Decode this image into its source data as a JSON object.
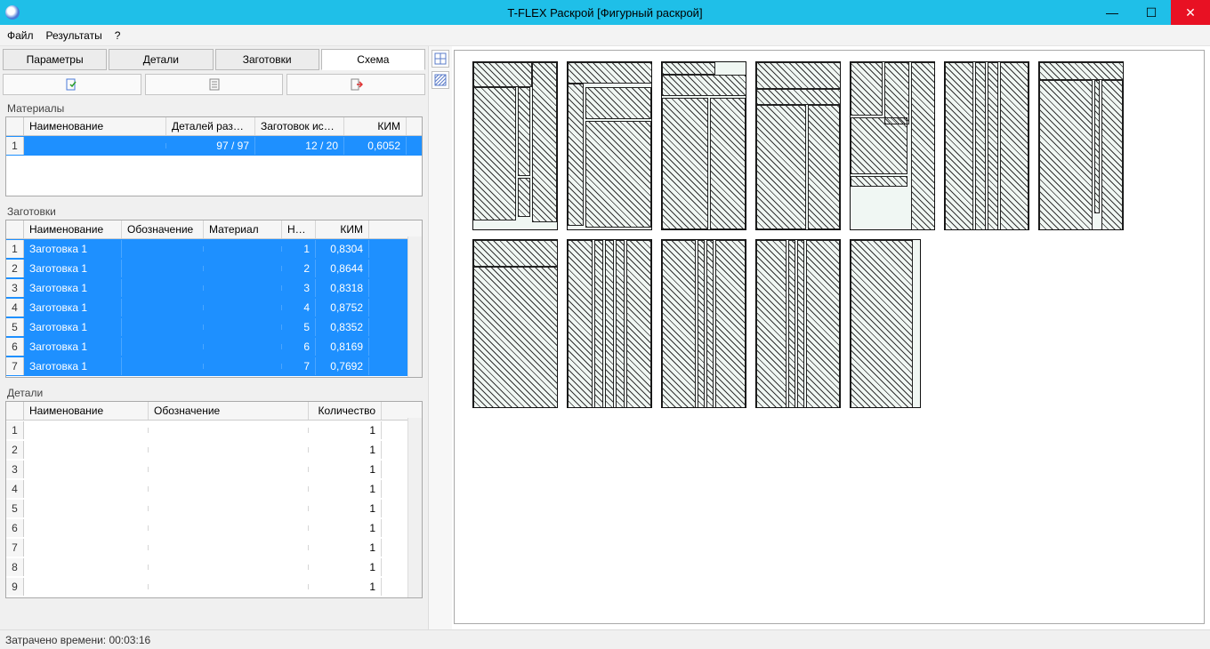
{
  "window": {
    "title": "T-FLEX Раскрой [Фигурный раскрой]"
  },
  "menu": {
    "file": "Файл",
    "results": "Результаты",
    "help": "?"
  },
  "tabs": {
    "params": "Параметры",
    "details": "Детали",
    "blanks": "Заготовки",
    "scheme": "Схема"
  },
  "sections": {
    "materials": "Материалы",
    "blanks": "Заготовки",
    "details": "Детали"
  },
  "materials": {
    "cols": {
      "name": "Наименование",
      "placed": "Деталей разме...",
      "blanks_used": "Заготовок испо...",
      "kim": "КИМ"
    },
    "rows": [
      {
        "n": "1",
        "name": "",
        "placed": "97 / 97",
        "blanks_used": "12 / 20",
        "kim": "0,6052"
      }
    ]
  },
  "blanks": {
    "cols": {
      "name": "Наименование",
      "desig": "Обозначение",
      "material": "Материал",
      "num": "Но...",
      "kim": "КИМ"
    },
    "rows": [
      {
        "n": "1",
        "name": "Заготовка 1",
        "num": "1",
        "kim": "0,8304"
      },
      {
        "n": "2",
        "name": "Заготовка 1",
        "num": "2",
        "kim": "0,8644"
      },
      {
        "n": "3",
        "name": "Заготовка 1",
        "num": "3",
        "kim": "0,8318"
      },
      {
        "n": "4",
        "name": "Заготовка 1",
        "num": "4",
        "kim": "0,8752"
      },
      {
        "n": "5",
        "name": "Заготовка 1",
        "num": "5",
        "kim": "0,8352"
      },
      {
        "n": "6",
        "name": "Заготовка 1",
        "num": "6",
        "kim": "0,8169"
      },
      {
        "n": "7",
        "name": "Заготовка 1",
        "num": "7",
        "kim": "0,7692"
      }
    ]
  },
  "details": {
    "cols": {
      "name": "Наименование",
      "desig": "Обозначение",
      "qty": "Количество"
    },
    "rows": [
      {
        "n": "1",
        "qty": "1"
      },
      {
        "n": "2",
        "qty": "1"
      },
      {
        "n": "3",
        "qty": "1"
      },
      {
        "n": "4",
        "qty": "1"
      },
      {
        "n": "5",
        "qty": "1"
      },
      {
        "n": "6",
        "qty": "1"
      },
      {
        "n": "7",
        "qty": "1"
      },
      {
        "n": "8",
        "qty": "1"
      },
      {
        "n": "9",
        "qty": "1"
      }
    ]
  },
  "status": {
    "elapsed_label": "Затрачено времени:",
    "elapsed_value": "00:03:16"
  }
}
